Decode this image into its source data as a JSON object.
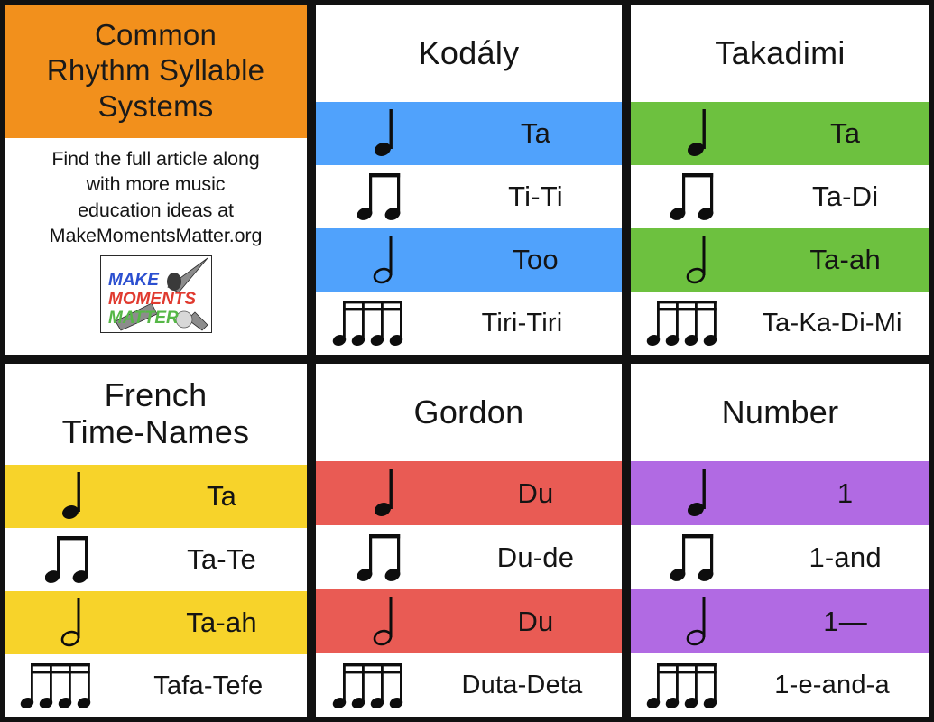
{
  "intro": {
    "title": "Common Rhythm Syllable Systems",
    "title_lines": [
      "Common",
      "Rhythm Syllable",
      "Systems"
    ],
    "body_lines": [
      "Find the full article along",
      "with more music",
      "education ideas at",
      "MakeMomentsMatter.org"
    ],
    "logo": {
      "line1": "MAKE",
      "line2": "MOMENTS",
      "line3": "MATTER",
      "line1_color": "#2b4fd0",
      "line2_color": "#e03a2f",
      "line3_color": "#56b747"
    },
    "header_color": "#F2901C"
  },
  "systems": [
    {
      "name": "Kodály",
      "accent": "#50A2FC",
      "rows": [
        {
          "note": "quarter-note",
          "syllable": "Ta",
          "shaded": true
        },
        {
          "note": "two-eighth-notes",
          "syllable": "Ti-Ti",
          "shaded": false
        },
        {
          "note": "half-note",
          "syllable": "Too",
          "shaded": true
        },
        {
          "note": "four-sixteenth-notes",
          "syllable": "Tiri-Tiri",
          "shaded": false
        }
      ]
    },
    {
      "name": "Takadimi",
      "accent": "#6DC13F",
      "rows": [
        {
          "note": "quarter-note",
          "syllable": "Ta",
          "shaded": true
        },
        {
          "note": "two-eighth-notes",
          "syllable": "Ta-Di",
          "shaded": false
        },
        {
          "note": "half-note",
          "syllable": "Ta-ah",
          "shaded": true
        },
        {
          "note": "four-sixteenth-notes",
          "syllable": "Ta-Ka-Di-Mi",
          "shaded": false
        }
      ]
    },
    {
      "name": "French Time-Names",
      "name_lines": [
        "French",
        "Time-Names"
      ],
      "accent": "#F7D32A",
      "rows": [
        {
          "note": "quarter-note",
          "syllable": "Ta",
          "shaded": true
        },
        {
          "note": "two-eighth-notes",
          "syllable": "Ta-Te",
          "shaded": false
        },
        {
          "note": "half-note",
          "syllable": "Ta-ah",
          "shaded": true
        },
        {
          "note": "four-sixteenth-notes",
          "syllable": "Tafa-Tefe",
          "shaded": false
        }
      ]
    },
    {
      "name": "Gordon",
      "accent": "#E95B54",
      "rows": [
        {
          "note": "quarter-note",
          "syllable": "Du",
          "shaded": true
        },
        {
          "note": "two-eighth-notes",
          "syllable": "Du-de",
          "shaded": false
        },
        {
          "note": "half-note",
          "syllable": "Du",
          "shaded": true
        },
        {
          "note": "four-sixteenth-notes",
          "syllable": "Duta-Deta",
          "shaded": false
        }
      ]
    },
    {
      "name": "Number",
      "accent": "#B16AE3",
      "rows": [
        {
          "note": "quarter-note",
          "syllable": "1",
          "shaded": true
        },
        {
          "note": "two-eighth-notes",
          "syllable": "1-and",
          "shaded": false
        },
        {
          "note": "half-note",
          "syllable": "1—",
          "shaded": true
        },
        {
          "note": "four-sixteenth-notes",
          "syllable": "1-e-and-a",
          "shaded": false
        }
      ]
    }
  ]
}
